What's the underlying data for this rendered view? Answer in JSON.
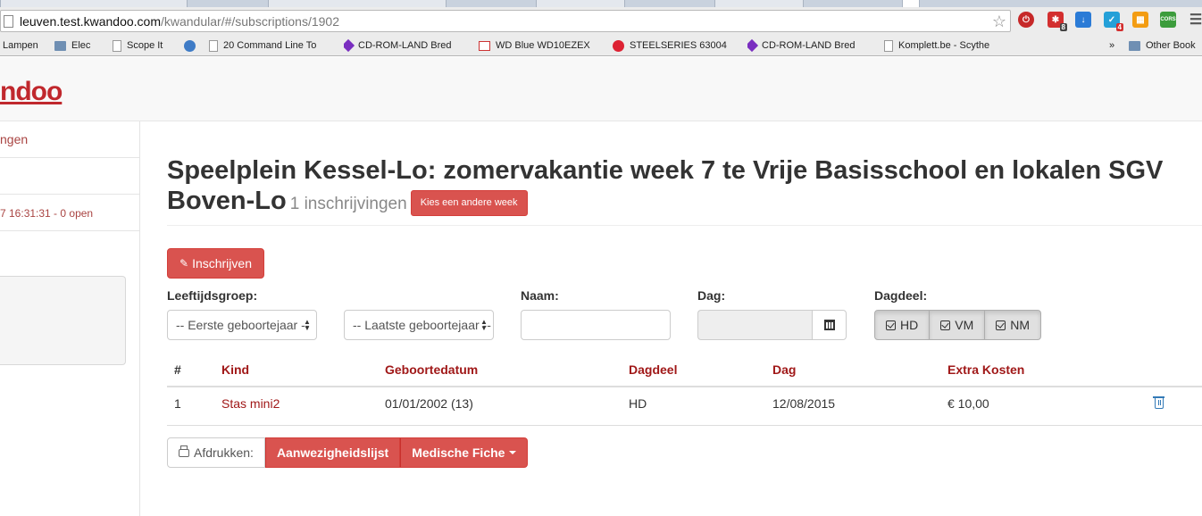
{
  "browser": {
    "url_host": "leuven.test.kwandoo.com",
    "url_path": "/kwandular/#/subscriptions/1902",
    "bookmarks": [
      {
        "label": "Lampen",
        "icon": "text"
      },
      {
        "label": "Elec",
        "icon": "folder"
      },
      {
        "label": "Scope It",
        "icon": "page"
      },
      {
        "label": "",
        "icon": "globe"
      },
      {
        "label": "20 Command Line To",
        "icon": "page"
      },
      {
        "label": "CD-ROM-LAND Bred",
        "icon": "purple-diamond"
      },
      {
        "label": "WD Blue WD10EZEX",
        "icon": "pix"
      },
      {
        "label": "STEELSERIES 63004",
        "icon": "red-swirl"
      },
      {
        "label": "CD-ROM-LAND Bred",
        "icon": "purple-diamond"
      },
      {
        "label": "Komplett.be - Scythe",
        "icon": "page"
      },
      {
        "label": "»",
        "icon": "none"
      },
      {
        "label": "Other Book",
        "icon": "folder"
      }
    ],
    "extension_badges": {
      "ext2": "8",
      "ext4": "4",
      "ext6": "CORS"
    }
  },
  "app": {
    "logo": "ndoo"
  },
  "sidebar": {
    "item1": "ngen",
    "item3": "7 16:31:31 - 0 open"
  },
  "main": {
    "title": "Speelplein Kessel-Lo: zomervakantie week 7 te Vrije Basisschool en lokalen SGV Boven-Lo",
    "subtitle": "1 inschrijvingen",
    "other_week_button": "Kies een andere week",
    "subscribe_button": "Inschrijven",
    "filters": {
      "age_label": "Leeftijdsgroep:",
      "age_from": "-- Eerste geboortejaar --",
      "age_to": "-- Laatste geboortejaar --",
      "name_label": "Naam:",
      "name_value": "",
      "day_label": "Dag:",
      "day_value": "",
      "part_label": "Dagdeel:",
      "parts": [
        "HD",
        "VM",
        "NM"
      ]
    },
    "table": {
      "headers": [
        "#",
        "Kind",
        "Geboortedatum",
        "Dagdeel",
        "Dag",
        "Extra Kosten"
      ],
      "rows": [
        {
          "nr": "1",
          "kind": "Stas mini2",
          "geboortedatum": "01/01/2002 (13)",
          "dagdeel": "HD",
          "dag": "12/08/2015",
          "extra": "€ 10,00"
        }
      ]
    },
    "print": {
      "label": "Afdrukken:",
      "attendance": "Aanwezigheidslijst",
      "medical": "Medische Fiche"
    }
  }
}
